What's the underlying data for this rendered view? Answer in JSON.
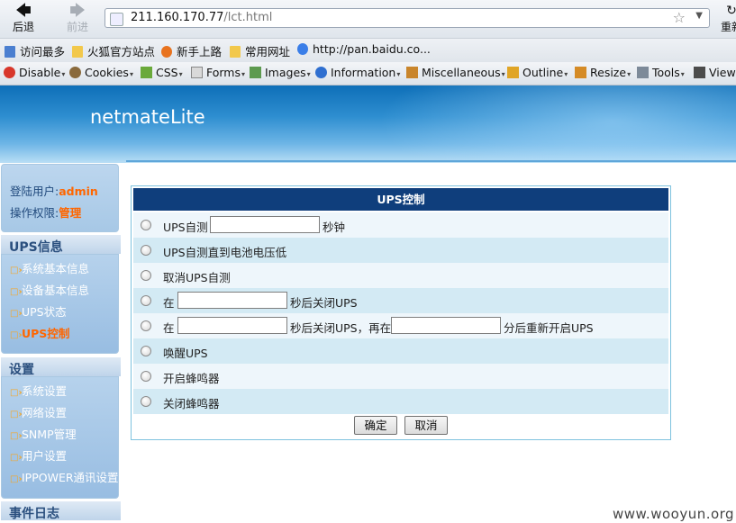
{
  "browser": {
    "back_label": "后退",
    "forward_label": "前进",
    "reload_label": "重新",
    "url_host": "211.160.170.77",
    "url_path": "/lct.html",
    "bookmarks": [
      "访问最多",
      "火狐官方站点",
      "新手上路",
      "常用网址",
      "http://pan.baidu.co..."
    ],
    "devtools": [
      "Disable",
      "Cookies",
      "CSS",
      "Forms",
      "Images",
      "Information",
      "Miscellaneous",
      "Outline",
      "Resize",
      "Tools",
      "View"
    ]
  },
  "header": {
    "brand": "netmateLite"
  },
  "user": {
    "user_label": "登陆用户:",
    "user_value": "admin",
    "perm_label": "操作权限:",
    "perm_value": "管理"
  },
  "sidebar": {
    "section_ups": "UPS信息",
    "ups_items": [
      "系统基本信息",
      "设备基本信息",
      "UPS状态",
      "UPS控制"
    ],
    "active_item": "UPS控制",
    "section_settings": "设置",
    "settings_items": [
      "系统设置",
      "网络设置",
      "SNMP管理",
      "用户设置",
      "IPPOWER通讯设置"
    ],
    "section_log": "事件日志"
  },
  "panel": {
    "title": "UPS控制",
    "options": {
      "self_test_a": "UPS自测",
      "self_test_b": "秒钟",
      "self_test_low": "UPS自测直到电池电压低",
      "cancel_test": "取消UPS自测",
      "shutdown_a": "在",
      "shutdown_b": "秒后关闭UPS",
      "restart_a": "在",
      "restart_b": "秒后关闭UPS，再在",
      "restart_c": "分后重新开启UPS",
      "wake": "唤醒UPS",
      "buzzer_on": "开启蜂鸣器",
      "buzzer_off": "关闭蜂鸣器"
    },
    "ok_label": "确定",
    "cancel_label": "取消"
  },
  "watermark": "www.wooyun.org",
  "colors": {
    "panel_header": "#0f3e7c",
    "row_light": "#eef6fb",
    "row_dark": "#d3eaf4",
    "accent_orange": "#ff6600",
    "sidebar_blue": "#a7c8e6"
  }
}
